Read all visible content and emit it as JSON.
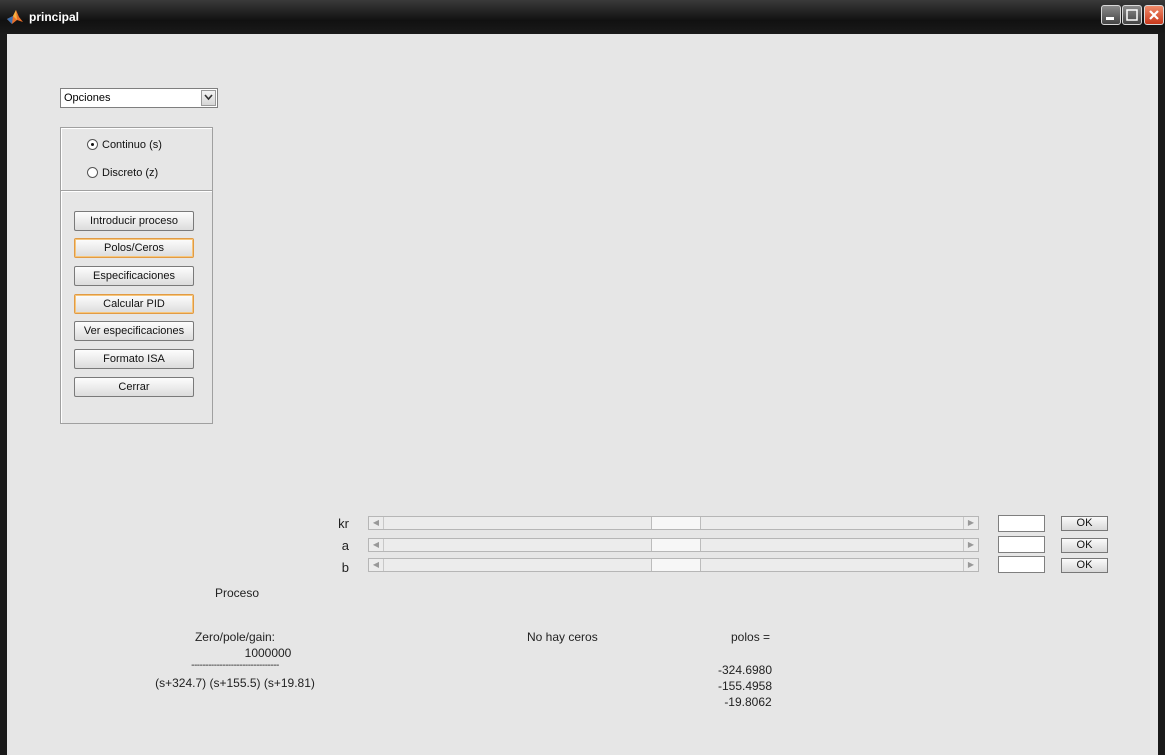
{
  "window": {
    "title": "principal"
  },
  "options_menu": {
    "selected": "Opciones"
  },
  "domain_radio": [
    {
      "label": "Continuo (s)",
      "checked": true
    },
    {
      "label": "Discreto (z)",
      "checked": false
    }
  ],
  "actions": [
    {
      "label": "Introducir proceso"
    },
    {
      "label": "Polos/Ceros"
    },
    {
      "label": "Especificaciones"
    },
    {
      "label": "Calcular PID"
    },
    {
      "label": "Ver especificaciones"
    },
    {
      "label": "Formato ISA"
    },
    {
      "label": "Cerrar"
    }
  ],
  "sliders": [
    {
      "label": "kr",
      "ok_label": "OK"
    },
    {
      "label": "a",
      "ok_label": "OK"
    },
    {
      "label": "b",
      "ok_label": "OK"
    }
  ],
  "process": {
    "heading": "Proceso",
    "zpk_label": "Zero/pole/gain:",
    "numerator": "1000000",
    "fraction_line": "-------------------------------",
    "denominator": "(s+324.7) (s+155.5) (s+19.81)",
    "zeros_text": "No hay ceros",
    "poles_label": "polos =",
    "poles": [
      "-324.6980",
      "-155.4958",
      "-19.8062"
    ]
  },
  "colors": {
    "highlight_border": "#e19b45",
    "close_button": "#c8381b"
  },
  "icons": {
    "app": "matlab-icon",
    "dropdown": "chevron-down-icon"
  }
}
